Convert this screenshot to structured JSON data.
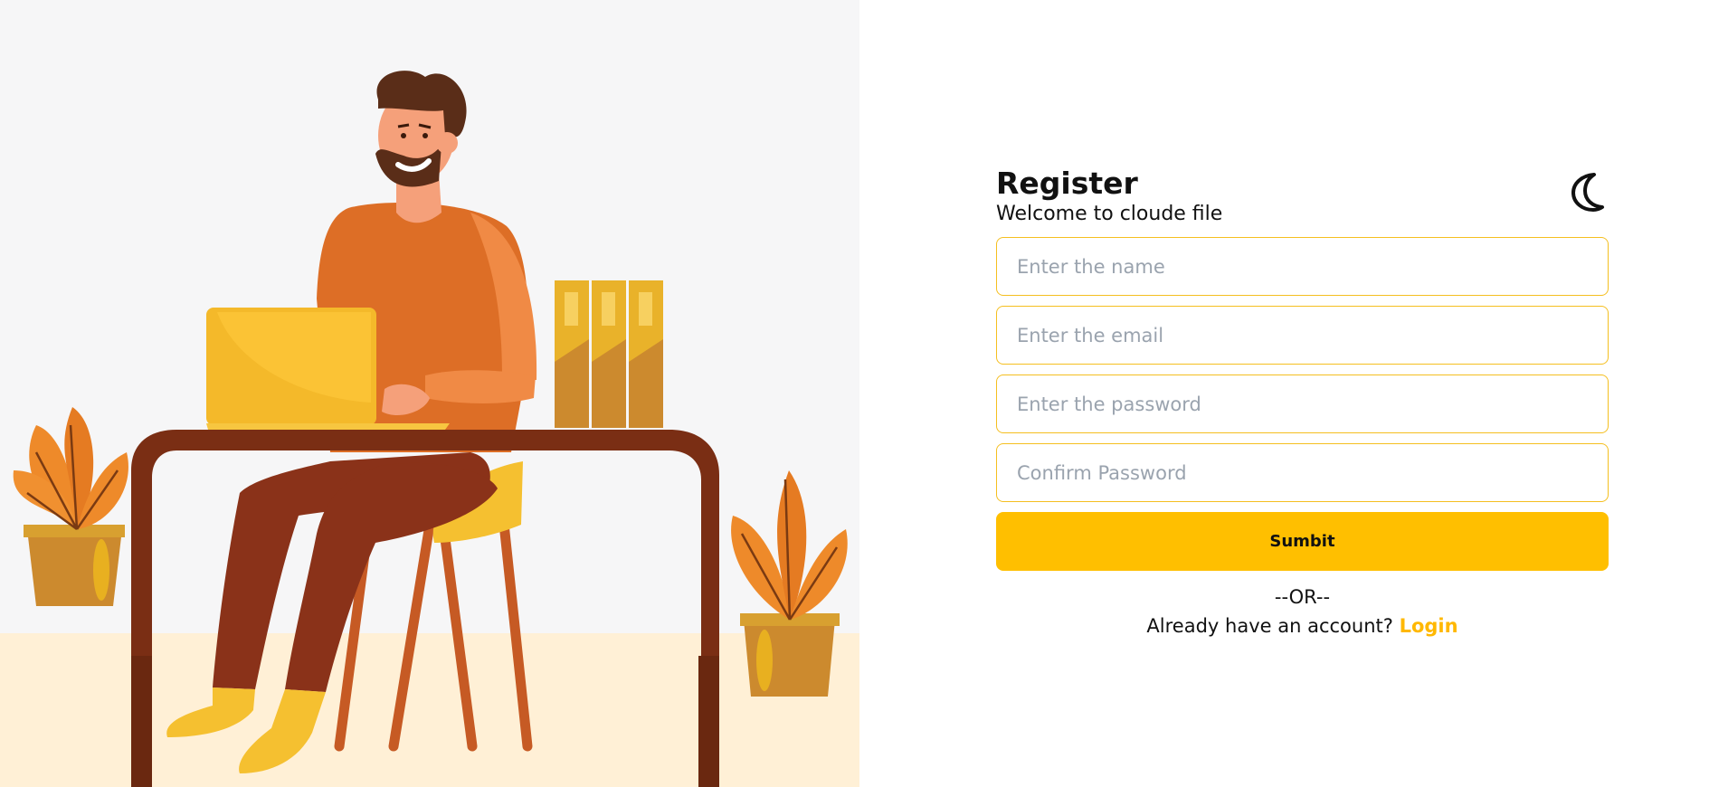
{
  "register": {
    "title": "Register",
    "subtitle": "Welcome to cloude file"
  },
  "theme_toggle": {
    "icon": "moon-icon"
  },
  "fields": {
    "name_placeholder": "Enter the name",
    "email_placeholder": "Enter the email",
    "password_placeholder": "Enter the password",
    "confirm_placeholder": "Confirm Password"
  },
  "submit": {
    "label": "Sumbit"
  },
  "divider": {
    "text": "--OR--"
  },
  "login_prompt": {
    "text": "Already have an account?",
    "link_label": "Login"
  },
  "colors": {
    "accent": "#ffbf00",
    "field_border": "#f5bf20",
    "login_link": "#ffb800",
    "illustration_bg": "#f6f6f7",
    "floor": "#fff0d6"
  }
}
